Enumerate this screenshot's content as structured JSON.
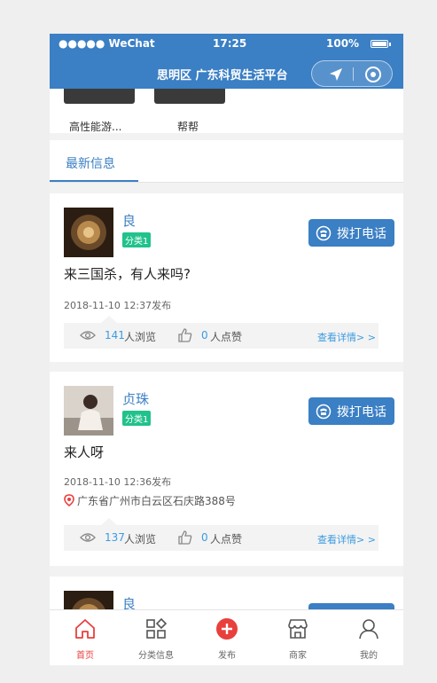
{
  "status_bar": {
    "carrier": "●●●●● WeChat",
    "time": "17:25",
    "battery": "100%"
  },
  "nav": {
    "title": "思明区 广东科贸生活平台",
    "location_icon": "navigation-arrow-icon",
    "close_icon": "target-circle-icon"
  },
  "categories": [
    {
      "label": "高性能游..."
    },
    {
      "label": "帮帮"
    }
  ],
  "section": {
    "title": "最新信息"
  },
  "posts": [
    {
      "name": "良",
      "tag": "分类1",
      "call_label": "拨打电话",
      "text": "来三国杀，有人来吗?",
      "date": "2018-11-10 12:37发布",
      "location": "",
      "views": "141",
      "views_label": "人浏览",
      "likes": "0",
      "likes_label": "人点赞",
      "detail_label": "查看详情> >"
    },
    {
      "name": "贞珠",
      "tag": "分类1",
      "call_label": "拨打电话",
      "text": "来人呀",
      "date": "2018-11-10 12:36发布",
      "location": "广东省广州市白云区石庆路388号",
      "views": "137",
      "views_label": "人浏览",
      "likes": "0",
      "likes_label": "人点赞",
      "detail_label": "查看详情> >"
    },
    {
      "name": "良"
    }
  ],
  "tabbar": [
    {
      "label": "首页",
      "icon": "home-icon",
      "active": true
    },
    {
      "label": "分类信息",
      "icon": "category-grid-icon",
      "active": false
    },
    {
      "label": "发布",
      "icon": "plus-circle-icon",
      "active": false
    },
    {
      "label": "商家",
      "icon": "shop-icon",
      "active": false
    },
    {
      "label": "我的",
      "icon": "user-icon",
      "active": false
    }
  ],
  "colors": {
    "primary": "#3b7fc4",
    "tag_green": "#21c28b",
    "accent_red": "#e8403d",
    "link_blue": "#3b9be0"
  }
}
